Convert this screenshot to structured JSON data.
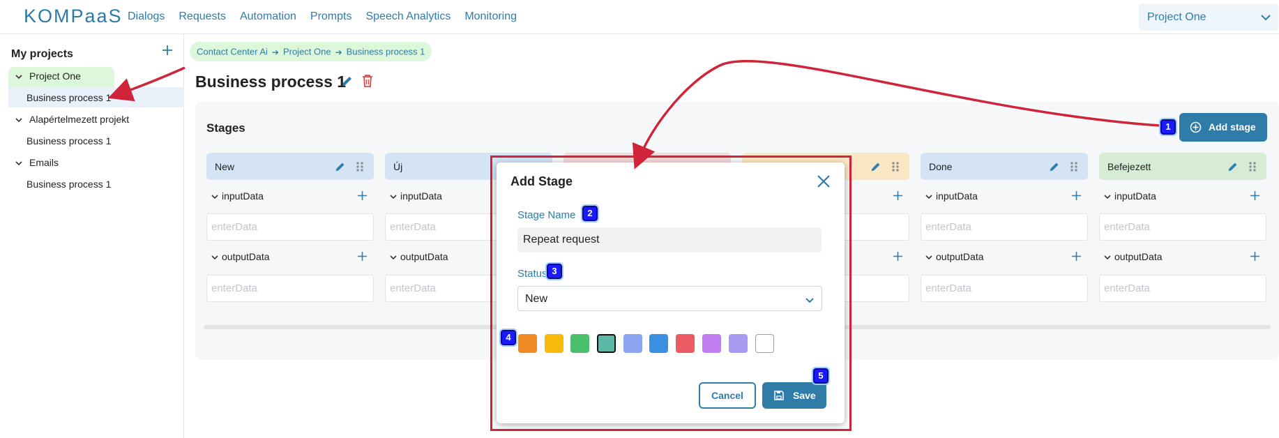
{
  "header": {
    "logo": "KOMPaaS",
    "nav": [
      "Dialogs",
      "Requests",
      "Automation",
      "Prompts",
      "Speech Analytics",
      "Monitoring"
    ],
    "project_select": "Project One"
  },
  "sidebar": {
    "title": "My projects",
    "projects": [
      {
        "name": "Project One",
        "process": "Business process 1"
      },
      {
        "name": "Alapértelmezett projekt",
        "process": "Business process 1"
      },
      {
        "name": "Emails",
        "process": "Business process 1"
      }
    ]
  },
  "breadcrumb": [
    "Contact Center Ai",
    "Project One",
    "Business process 1"
  ],
  "page": {
    "title": "Business process 1"
  },
  "stages": {
    "title": "Stages",
    "add_label": "Add stage",
    "section_input": "inputData",
    "section_output": "outputData",
    "placeholder": "enterData",
    "columns": [
      {
        "name": "New"
      },
      {
        "name": "Új"
      },
      {
        "name": ""
      },
      {
        "name": ""
      },
      {
        "name": "Done"
      },
      {
        "name": "Befejezett"
      }
    ]
  },
  "modal": {
    "title": "Add Stage",
    "stage_name_label": "Stage Name",
    "stage_name_value": "Repeat request",
    "status_label": "Status",
    "status_value": "New",
    "colors": [
      "#f08a24",
      "#f6b90c",
      "#4bbf6b",
      "#5cb7a6",
      "#8aa4ef",
      "#3a8fe0",
      "#ec5b64",
      "#c17ef0",
      "#a89af0",
      "#ffffff"
    ],
    "cancel_label": "Cancel",
    "save_label": "Save"
  },
  "badges": [
    "1",
    "2",
    "3",
    "4",
    "5"
  ],
  "colors": {
    "accent": "#2f7ca8",
    "highlight_green": "#dcf7d9",
    "annotation_red": "#d0243a"
  }
}
